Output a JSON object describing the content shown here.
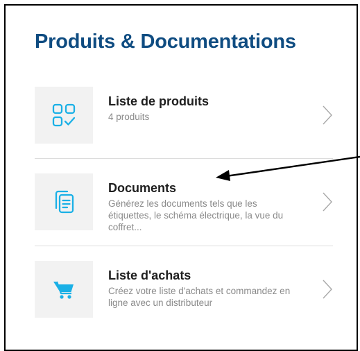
{
  "page": {
    "title": "Produits & Documentations"
  },
  "menu": {
    "items": [
      {
        "title": "Liste de produits",
        "description": "4 produits",
        "icon": "product-grid-check-icon"
      },
      {
        "title": "Documents",
        "description": "Générez les documents tels que les étiquettes, le schéma électrique, la vue du coffret...",
        "icon": "documents-stack-icon"
      },
      {
        "title": "Liste d'achats",
        "description": "Créez votre liste d'achats et commandez en ligne avec un distributeur",
        "icon": "shopping-cart-icon"
      }
    ]
  },
  "colors": {
    "title": "#0f4c81",
    "icon_accent": "#1ab0e6",
    "tile_background": "#f2f2f2",
    "divider": "#dcdcdc",
    "chevron": "#a8a8a8"
  }
}
